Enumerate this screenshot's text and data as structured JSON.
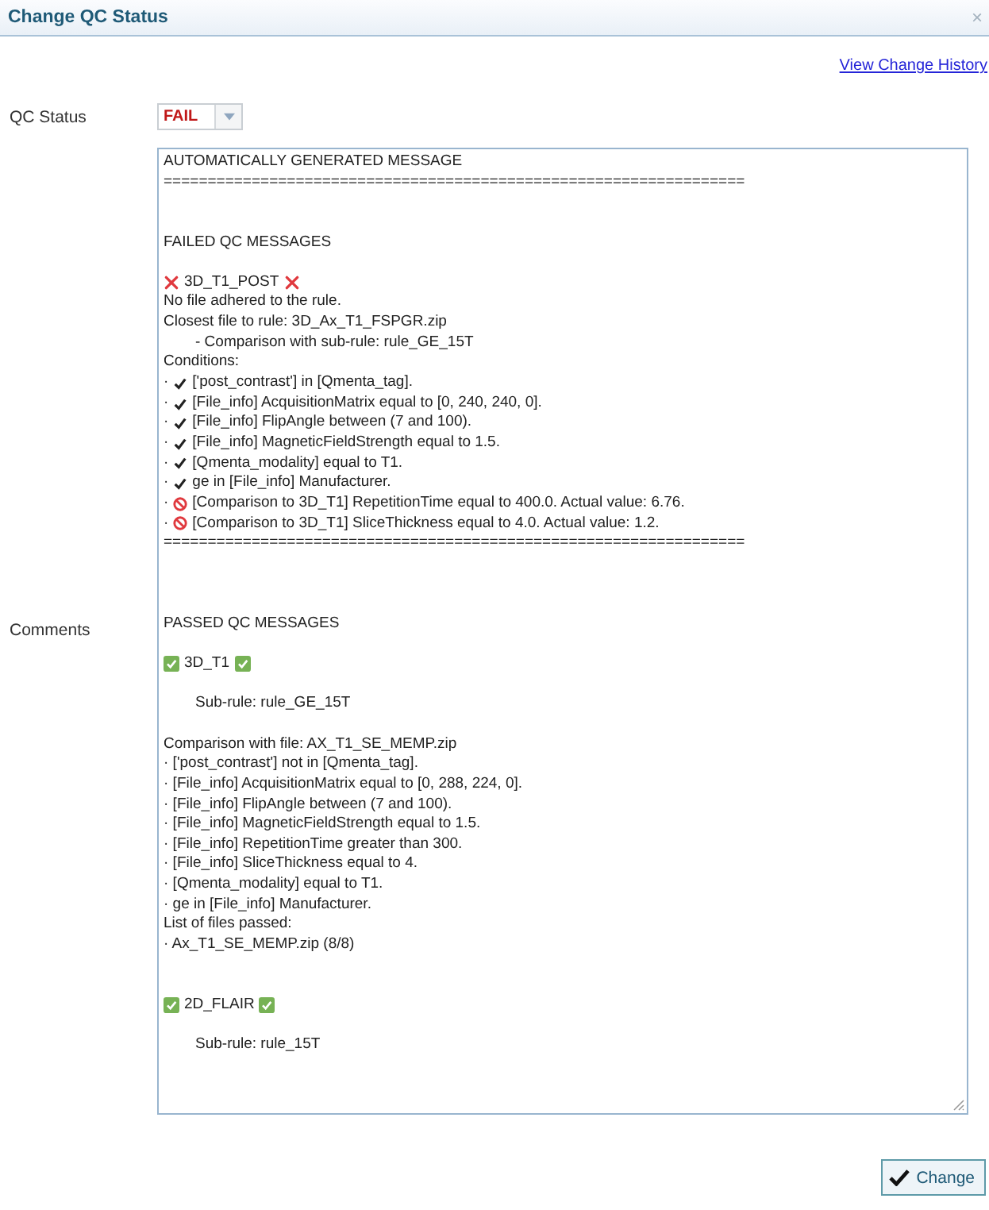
{
  "window": {
    "title": "Change QC Status",
    "close": "×"
  },
  "history_link": "View Change History",
  "qc_status": {
    "label": "QC Status",
    "value": "FAIL"
  },
  "comments": {
    "label": "Comments",
    "lines": [
      {
        "kind": "text",
        "text": "AUTOMATICALLY GENERATED MESSAGE"
      },
      {
        "kind": "text",
        "text": "=================================================================="
      },
      {
        "kind": "blank"
      },
      {
        "kind": "blank"
      },
      {
        "kind": "text",
        "text": "FAILED QC MESSAGES"
      },
      {
        "kind": "blank"
      },
      {
        "kind": "title",
        "passed": false,
        "text": "3D_T1_POST"
      },
      {
        "kind": "text",
        "text": "No file adhered to the rule."
      },
      {
        "kind": "text",
        "text": "Closest file to rule: 3D_Ax_T1_FSPGR.zip"
      },
      {
        "kind": "text",
        "indent": true,
        "text": "- Comparison with sub-rule: rule_GE_15T"
      },
      {
        "kind": "text",
        "text": "Conditions:"
      },
      {
        "kind": "condition",
        "bullet": "·",
        "passed": true,
        "text": "['post_contrast'] in [Qmenta_tag]."
      },
      {
        "kind": "condition",
        "bullet": "·",
        "passed": true,
        "text": "[File_info] AcquisitionMatrix equal to [0, 240, 240, 0]."
      },
      {
        "kind": "condition",
        "bullet": "·",
        "passed": true,
        "text": "[File_info] FlipAngle between (7 and 100)."
      },
      {
        "kind": "condition",
        "bullet": "·",
        "passed": true,
        "text": "[File_info] MagneticFieldStrength equal to 1.5."
      },
      {
        "kind": "condition",
        "bullet": "·",
        "passed": true,
        "text": "[Qmenta_modality] equal to T1."
      },
      {
        "kind": "condition",
        "bullet": "·",
        "passed": true,
        "text": "ge in [File_info] Manufacturer."
      },
      {
        "kind": "condition",
        "bullet": "·",
        "passed": false,
        "text": "[Comparison to 3D_T1] RepetitionTime equal to 400.0. Actual value: 6.76."
      },
      {
        "kind": "condition",
        "bullet": "·",
        "passed": false,
        "text": "[Comparison to 3D_T1] SliceThickness equal to 4.0. Actual value: 1.2."
      },
      {
        "kind": "text",
        "text": "=================================================================="
      },
      {
        "kind": "blank"
      },
      {
        "kind": "blank"
      },
      {
        "kind": "blank"
      },
      {
        "kind": "text",
        "text": "PASSED QC MESSAGES"
      },
      {
        "kind": "blank"
      },
      {
        "kind": "title",
        "passed": true,
        "text": "3D_T1"
      },
      {
        "kind": "blank"
      },
      {
        "kind": "text",
        "indent": true,
        "text": "Sub-rule: rule_GE_15T"
      },
      {
        "kind": "blank"
      },
      {
        "kind": "text",
        "text": "Comparison with file: AX_T1_SE_MEMP.zip"
      },
      {
        "kind": "text",
        "text": "· ['post_contrast'] not in [Qmenta_tag]."
      },
      {
        "kind": "text",
        "text": "· [File_info] AcquisitionMatrix equal to [0, 288, 224, 0]."
      },
      {
        "kind": "text",
        "text": "· [File_info] FlipAngle between (7 and 100)."
      },
      {
        "kind": "text",
        "text": "· [File_info] MagneticFieldStrength equal to 1.5."
      },
      {
        "kind": "text",
        "text": "· [File_info] RepetitionTime greater than 300."
      },
      {
        "kind": "text",
        "text": "· [File_info] SliceThickness equal to 4."
      },
      {
        "kind": "text",
        "text": "· [Qmenta_modality] equal to T1."
      },
      {
        "kind": "text",
        "text": "· ge in [File_info] Manufacturer."
      },
      {
        "kind": "text",
        "text": "List of files passed:"
      },
      {
        "kind": "text",
        "text": "· Ax_T1_SE_MEMP.zip (8/8)"
      },
      {
        "kind": "blank"
      },
      {
        "kind": "blank"
      },
      {
        "kind": "title",
        "passed": true,
        "text": "2D_FLAIR"
      },
      {
        "kind": "blank"
      },
      {
        "kind": "text",
        "indent": true,
        "text": "Sub-rule: rule_15T"
      }
    ]
  },
  "buttons": [
    {
      "kind": "confirm",
      "label": "Change"
    }
  ]
}
